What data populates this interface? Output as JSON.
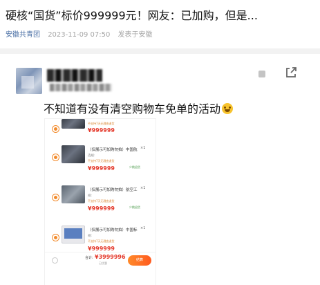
{
  "article": {
    "title": "硬核“国货”标价999999元！网友：已加购，但是...",
    "source": "安徽共青团",
    "datetime": "2023-11-09 07:50",
    "location": "发表于安徽"
  },
  "post": {
    "text": "不知道有没有清空购物车免单的活动",
    "emoji": "grinning-sweat-face",
    "icons": {
      "share": "share-icon",
      "more": "more-dot"
    }
  },
  "cart": {
    "items": [
      {
        "name": "",
        "spec": "",
        "tag": "不支持7天无理由退货",
        "price": "¥999999",
        "qty": "",
        "remove": "",
        "thumb": "dark"
      },
      {
        "name": "（仅展示可加购勿拍）中国航",
        "spec": "选规:",
        "tag": "不支持7天无理由退货",
        "price": "¥999999",
        "qty": "×1",
        "remove": "少桃退货",
        "thumb": "dark"
      },
      {
        "name": "（仅展示可加购勿拍）航空工",
        "spec": "规:",
        "tag": "不支持7天无理由退货",
        "price": "¥999999",
        "qty": "×1",
        "remove": "少桃退货",
        "thumb": "mid"
      },
      {
        "name": "（仅展示可加购勿拍）中国标",
        "spec": "规:",
        "tag": "不支持7天无理由退货",
        "price": "¥999999",
        "qty": "×1",
        "remove": "",
        "thumb": "screen"
      }
    ],
    "footer": {
      "total_label": "合计:",
      "total_price": "¥3999996",
      "total_sub": "已优惠",
      "checkout_label": "结算"
    }
  }
}
